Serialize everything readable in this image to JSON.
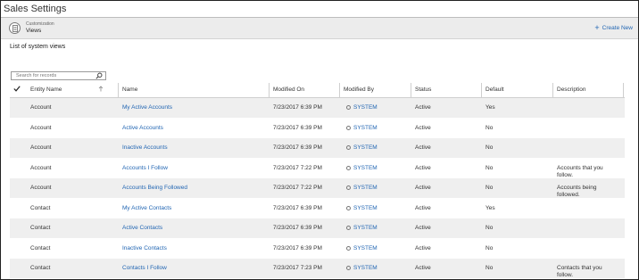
{
  "app": {
    "title": "Sales Settings"
  },
  "subheader": {
    "crumb_small": "Customization",
    "crumb_main": "Views",
    "create_new": "Create New"
  },
  "section_title": "List of system views",
  "search": {
    "placeholder": "Search for records"
  },
  "columns": [
    "Entity Name",
    "Name",
    "Modified On",
    "Modified By",
    "Status",
    "Default",
    "Description"
  ],
  "rows": [
    {
      "entity": "Account",
      "name": "My Active Accounts",
      "modified_on": "7/23/2017 6:39 PM",
      "modified_by": "SYSTEM",
      "status": "Active",
      "default": "Yes",
      "description": ""
    },
    {
      "entity": "Account",
      "name": "Active Accounts",
      "modified_on": "7/23/2017 6:39 PM",
      "modified_by": "SYSTEM",
      "status": "Active",
      "default": "No",
      "description": ""
    },
    {
      "entity": "Account",
      "name": "Inactive Accounts",
      "modified_on": "7/23/2017 6:39 PM",
      "modified_by": "SYSTEM",
      "status": "Active",
      "default": "No",
      "description": ""
    },
    {
      "entity": "Account",
      "name": "Accounts I Follow",
      "modified_on": "7/23/2017 7:22 PM",
      "modified_by": "SYSTEM",
      "status": "Active",
      "default": "No",
      "description": "Accounts that you follow."
    },
    {
      "entity": "Account",
      "name": "Accounts Being Followed",
      "modified_on": "7/23/2017 7:22 PM",
      "modified_by": "SYSTEM",
      "status": "Active",
      "default": "No",
      "description": "Accounts being followed."
    },
    {
      "entity": "Contact",
      "name": "My Active Contacts",
      "modified_on": "7/23/2017 6:39 PM",
      "modified_by": "SYSTEM",
      "status": "Active",
      "default": "Yes",
      "description": ""
    },
    {
      "entity": "Contact",
      "name": "Active Contacts",
      "modified_on": "7/23/2017 6:39 PM",
      "modified_by": "SYSTEM",
      "status": "Active",
      "default": "No",
      "description": ""
    },
    {
      "entity": "Contact",
      "name": "Inactive Contacts",
      "modified_on": "7/23/2017 6:39 PM",
      "modified_by": "SYSTEM",
      "status": "Active",
      "default": "No",
      "description": ""
    },
    {
      "entity": "Contact",
      "name": "Contacts I Follow",
      "modified_on": "7/23/2017 7:23 PM",
      "modified_by": "SYSTEM",
      "status": "Active",
      "default": "No",
      "description": "Contacts that you follow."
    }
  ],
  "colors": {
    "link": "#2266b3",
    "alt_row": "#efefef"
  }
}
